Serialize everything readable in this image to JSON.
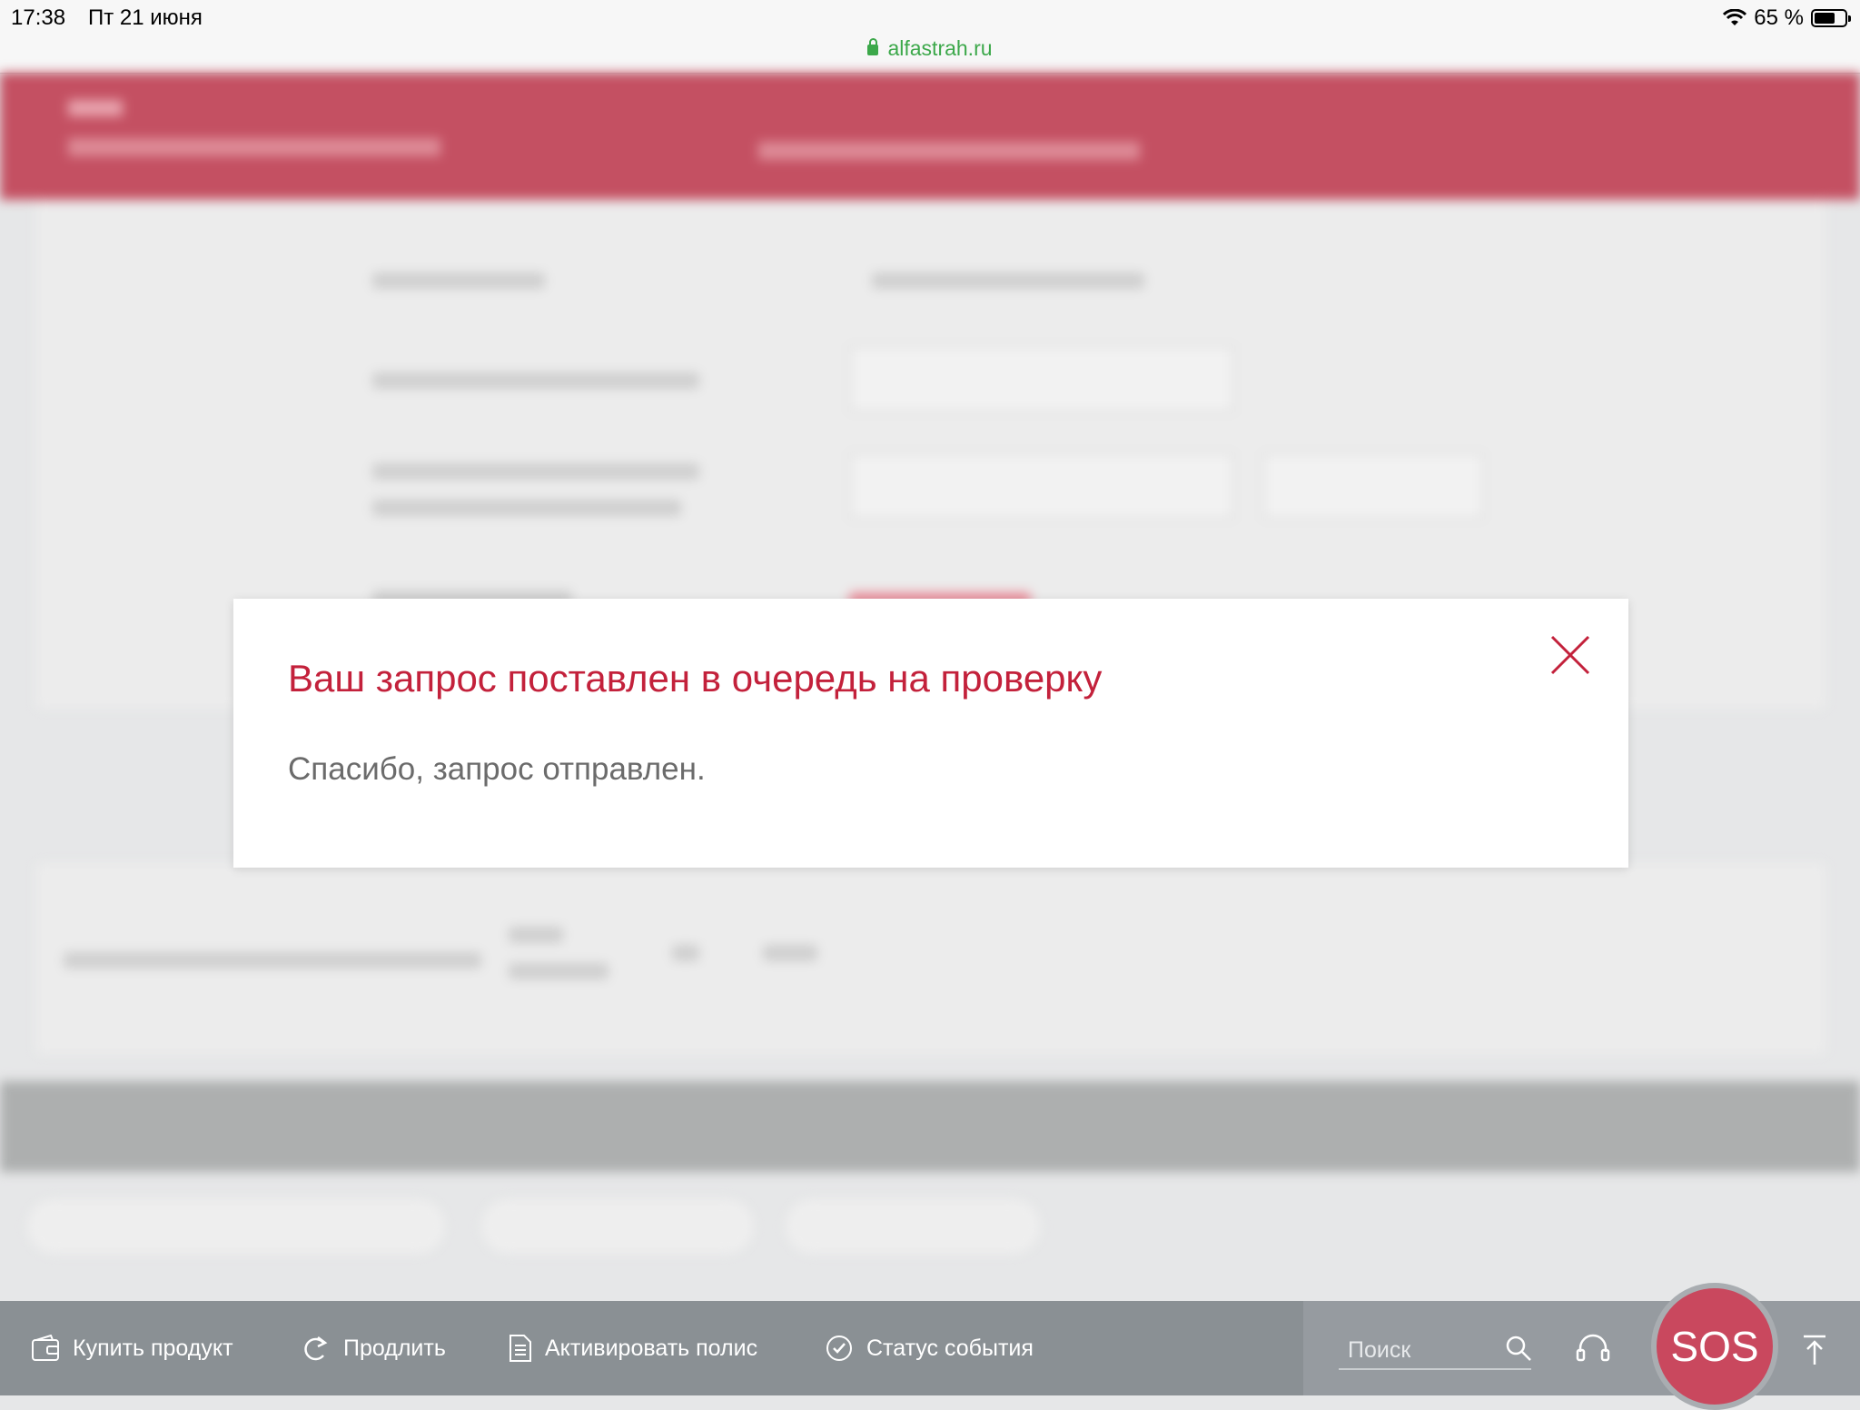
{
  "status_bar": {
    "time": "17:38",
    "date": "Пт 21 июня",
    "url": "alfastrah.ru",
    "battery": "65 %"
  },
  "modal": {
    "title": "Ваш запрос поставлен в очередь на проверку",
    "message": "Спасибо, запрос отправлен.",
    "close_icon": "close-icon"
  },
  "toolbar": {
    "items": [
      {
        "label": "Купить продукт",
        "icon": "wallet-icon"
      },
      {
        "label": "Продлить",
        "icon": "redo-arrow-icon"
      },
      {
        "label": "Активировать полис",
        "icon": "document-icon"
      },
      {
        "label": "Статус события",
        "icon": "check-circle-icon"
      }
    ],
    "search_placeholder": "Поиск",
    "sos_label": "SOS"
  },
  "colors": {
    "brand_red": "#c3213b",
    "header_red": "#c45062",
    "toolbar_gray": "#8a9094",
    "sos_red": "#c9485e",
    "url_green": "#3ca84a"
  }
}
